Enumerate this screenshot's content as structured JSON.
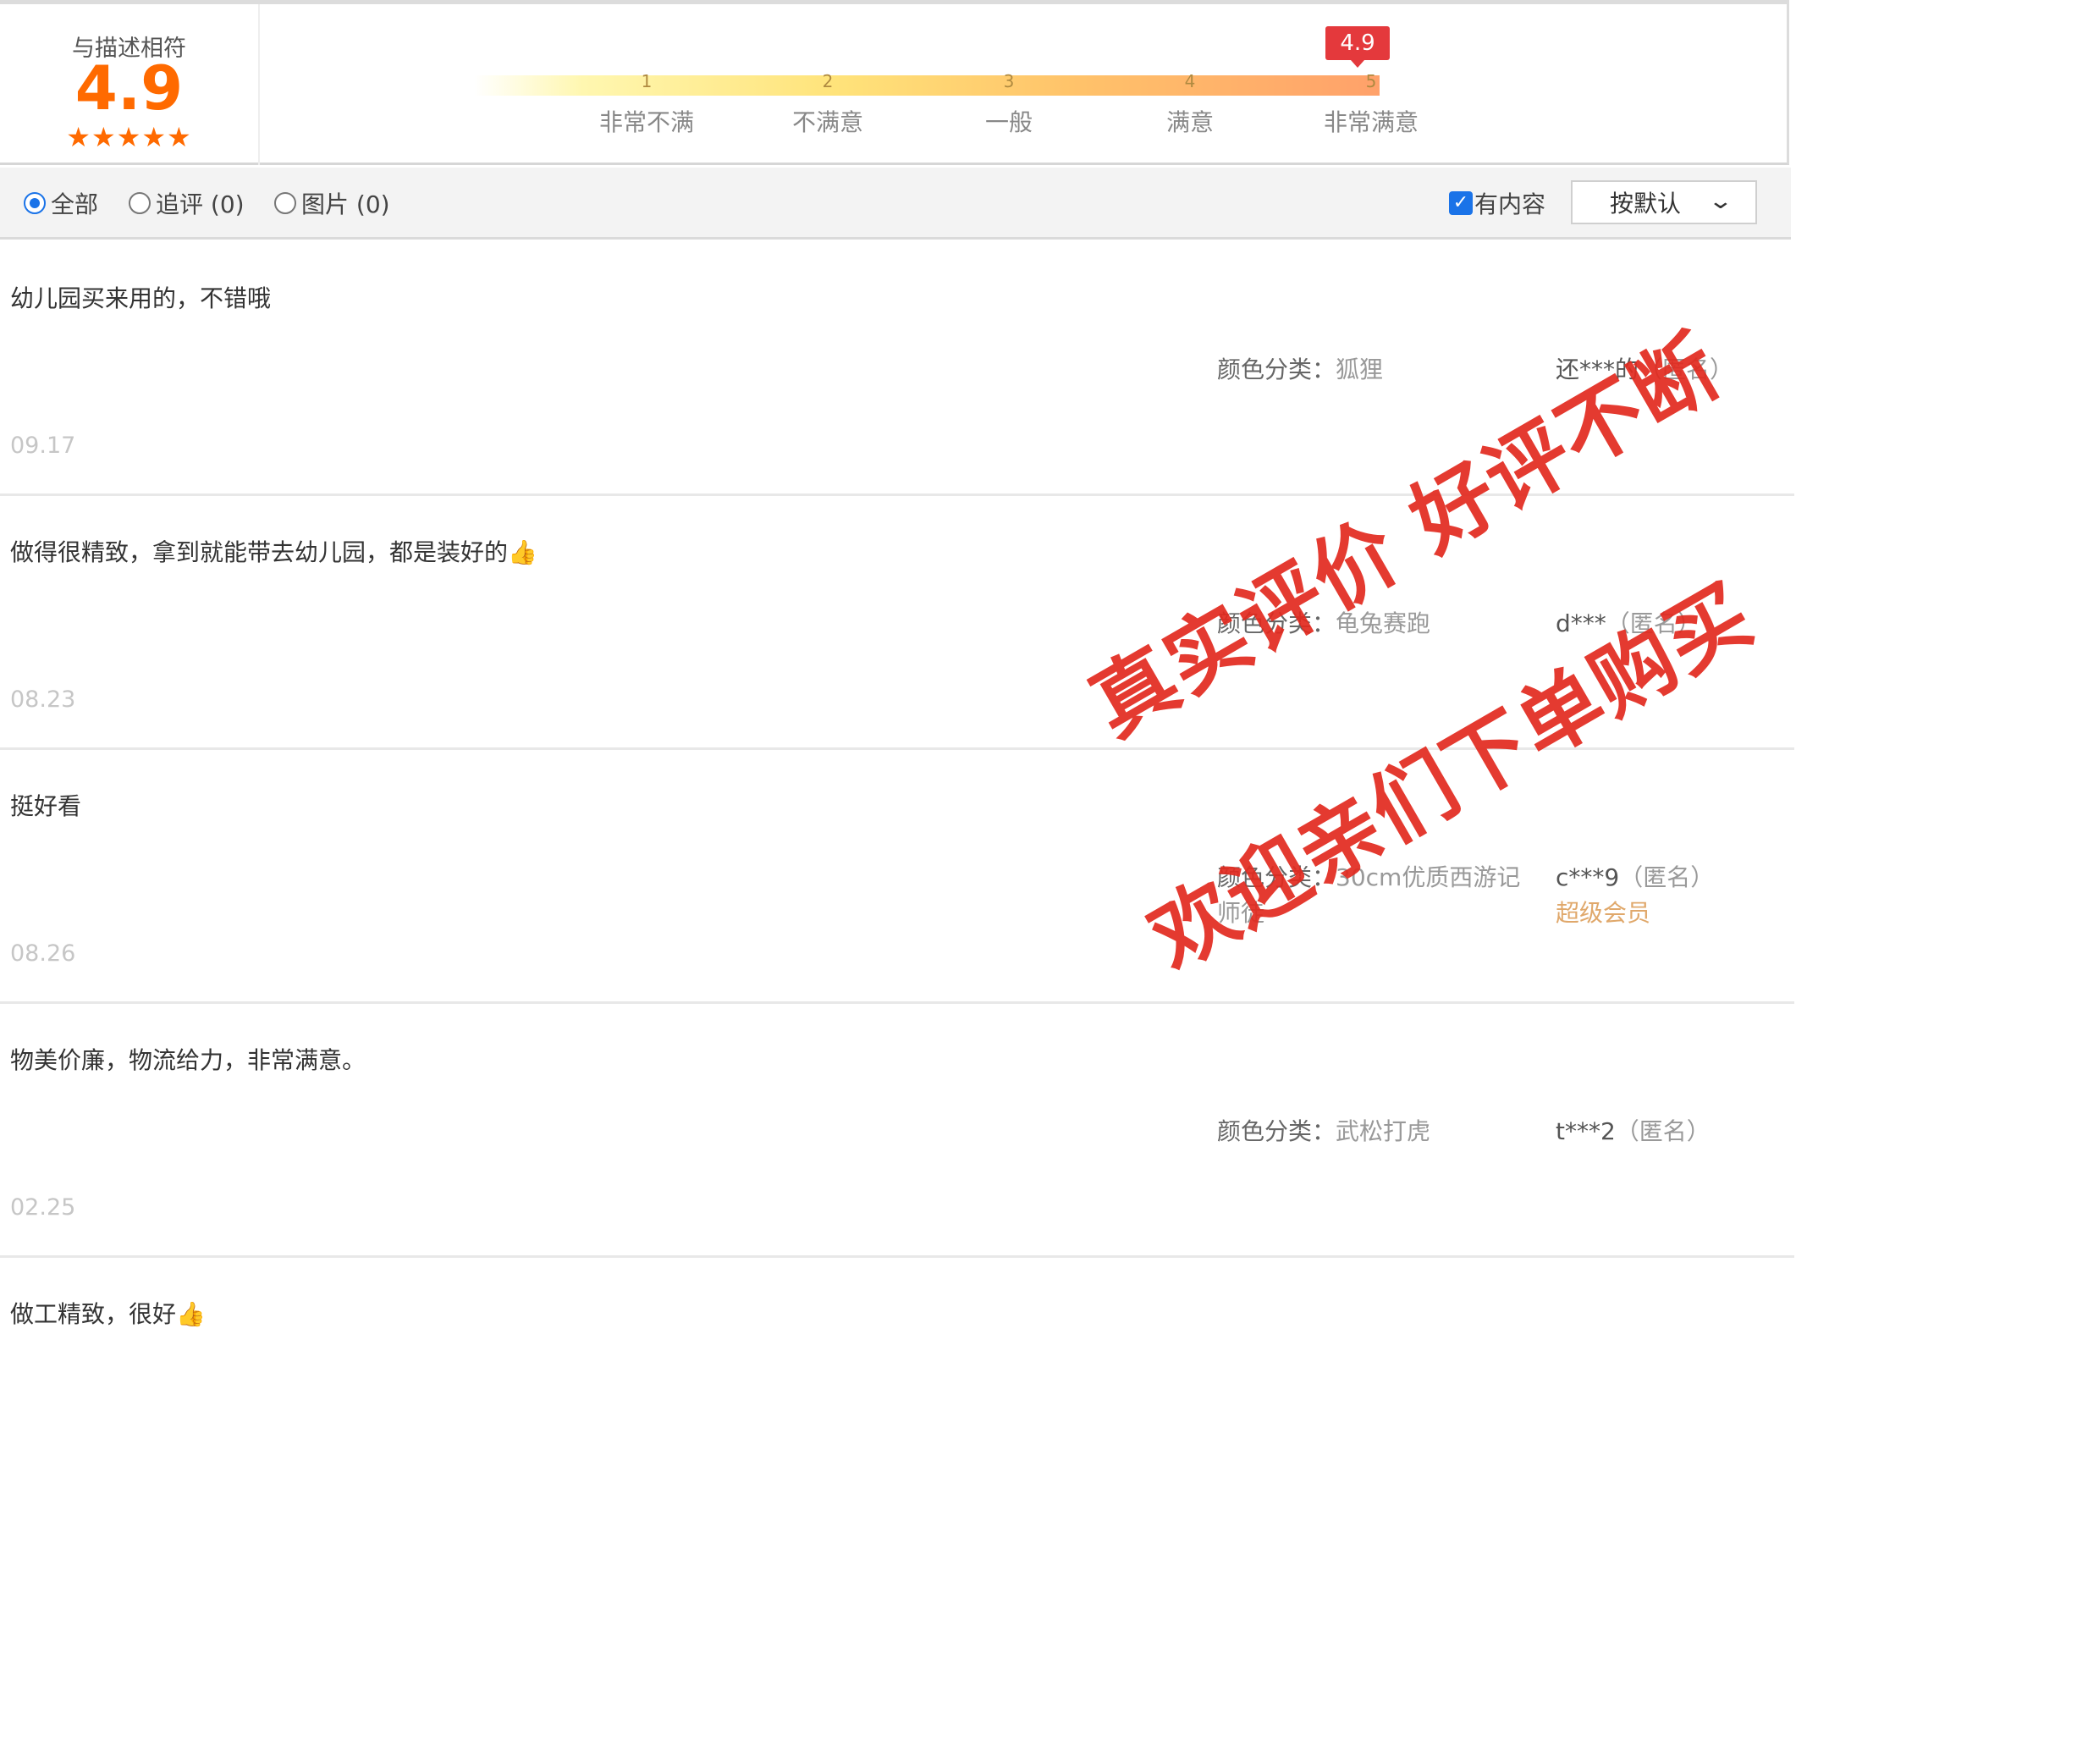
{
  "rating": {
    "label": "与描述相符",
    "score": "4.9",
    "stars": "★★★★★",
    "flag": "4.9",
    "scale": [
      {
        "num": "1",
        "label": "非常不满"
      },
      {
        "num": "2",
        "label": "不满意"
      },
      {
        "num": "3",
        "label": "一般"
      },
      {
        "num": "4",
        "label": "满意"
      },
      {
        "num": "5",
        "label": "非常满意"
      }
    ]
  },
  "filters": {
    "all": "全部",
    "followup": "追评 (0)",
    "images": "图片 (0)",
    "has_content": "有内容",
    "sort": "按默认"
  },
  "reviews": [
    {
      "text": "幼儿园买来用的，不错哦",
      "sku_label": "颜色分类：",
      "sku_value": "狐狸",
      "user": "还***的",
      "anon": "（匿名）",
      "date": "09.17"
    },
    {
      "text": "做得很精致，拿到就能带去幼儿园，都是装好的👍",
      "sku_label": "颜色分类：",
      "sku_value": "龟兔赛跑",
      "user": "d***",
      "anon": "（匿名）",
      "date": "08.23"
    },
    {
      "text": "挺好看",
      "sku_label": "颜色分类：",
      "sku_value": "30cm优质西游记师徒",
      "user": "c***9",
      "anon": "（匿名）",
      "member": "超级会员",
      "date": "08.26"
    },
    {
      "text": "物美价廉，物流给力，非常满意。",
      "sku_label": "颜色分类：",
      "sku_value": "武松打虎",
      "user": "t***2",
      "anon": "（匿名）",
      "date": "02.25"
    },
    {
      "text": "做工精致，很好👍"
    }
  ],
  "watermark": {
    "line1": "真实评价 好评不断",
    "line2": "欢迎亲们下单购买"
  },
  "colors": {
    "accent": "#ff6a00",
    "flag": "#e4393c",
    "watermark": "#e22a1f",
    "member": "#e0a86b"
  }
}
